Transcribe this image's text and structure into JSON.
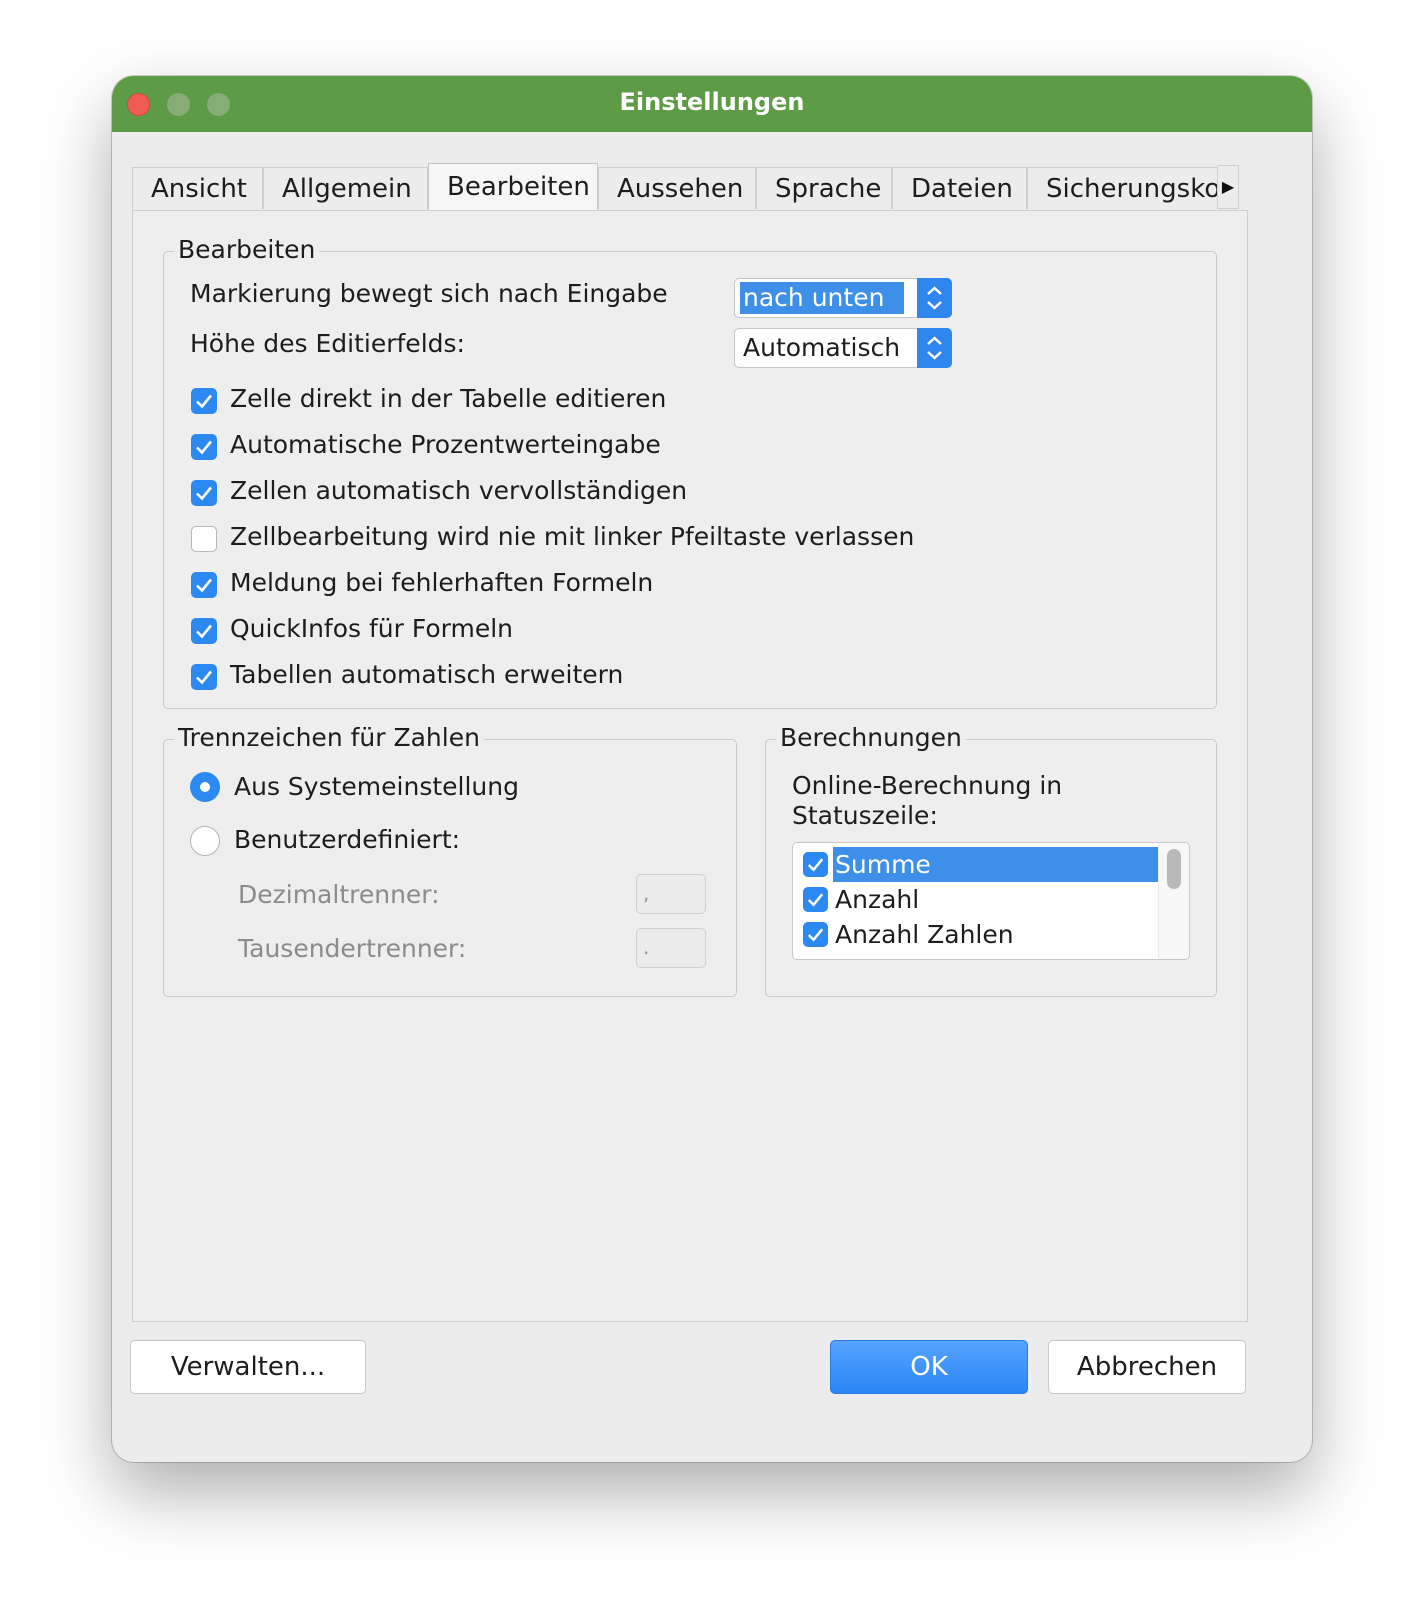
{
  "window": {
    "title": "Einstellungen"
  },
  "tabs": [
    {
      "label": "Ansicht"
    },
    {
      "label": "Allgemein"
    },
    {
      "label": "Bearbeiten"
    },
    {
      "label": "Aussehen"
    },
    {
      "label": "Sprache"
    },
    {
      "label": "Dateien"
    },
    {
      "label": "Sicherungskop"
    }
  ],
  "edit_group": {
    "legend": "Bearbeiten",
    "move_label": "Markierung bewegt sich nach Eingabe",
    "move_value": "nach unten",
    "height_label": "Höhe des Editierfelds:",
    "height_value": "Automatisch",
    "checkboxes": [
      {
        "label": "Zelle direkt in der Tabelle editieren",
        "checked": true
      },
      {
        "label": "Automatische Prozentwerteingabe",
        "checked": true
      },
      {
        "label": "Zellen automatisch vervollständigen",
        "checked": true
      },
      {
        "label": "Zellbearbeitung wird nie mit linker Pfeiltaste verlassen",
        "checked": false
      },
      {
        "label": "Meldung bei fehlerhaften Formeln",
        "checked": true
      },
      {
        "label": "QuickInfos für Formeln",
        "checked": true
      },
      {
        "label": "Tabellen automatisch erweitern",
        "checked": true
      }
    ]
  },
  "separator_group": {
    "legend": "Trennzeichen für Zahlen",
    "system_label": "Aus Systemeinstellung",
    "custom_label": "Benutzerdefiniert:",
    "decimal_label": "Dezimaltrenner:",
    "decimal_value": ",",
    "thousands_label": "Tausendertrenner:",
    "thousands_value": ".",
    "selected": "system"
  },
  "calc_group": {
    "legend": "Berechnungen",
    "online_label_line1": "Online-Berechnung in",
    "online_label_line2": "Statuszeile:",
    "items": [
      {
        "label": "Summe",
        "checked": true,
        "selected": true
      },
      {
        "label": "Anzahl",
        "checked": true,
        "selected": false
      },
      {
        "label": "Anzahl Zahlen",
        "checked": true,
        "selected": false
      }
    ]
  },
  "buttons": {
    "manage": "Verwalten...",
    "ok": "OK",
    "cancel": "Abbrechen"
  },
  "colors": {
    "titlebar": "#5e9b47",
    "accent": "#2c89f2",
    "close": "#ee5c54"
  }
}
